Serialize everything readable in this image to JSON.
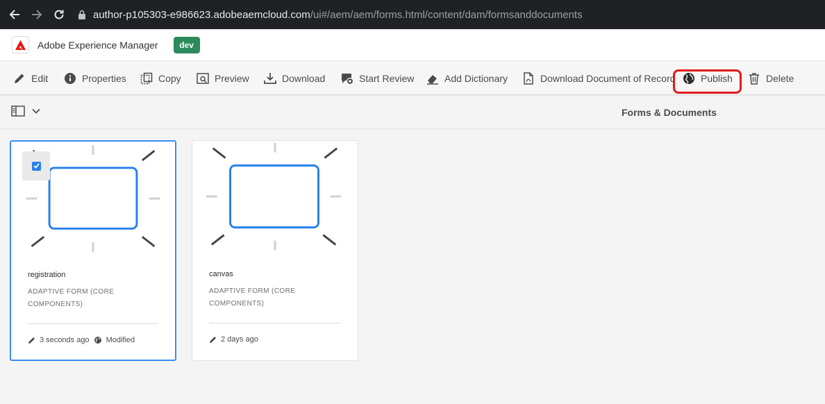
{
  "browser": {
    "url_host": "author-p105303-e986623.adobeaemcloud.com",
    "url_path": "/ui#/aem/aem/forms.html/content/dam/formsanddocuments"
  },
  "header": {
    "app_title": "Adobe Experience Manager",
    "env_badge": "dev"
  },
  "actions": [
    {
      "label": "Edit",
      "icon": "pencil-icon"
    },
    {
      "label": "Properties",
      "icon": "info-icon"
    },
    {
      "label": "Copy",
      "icon": "copy-icon"
    },
    {
      "label": "Preview",
      "icon": "preview-icon"
    },
    {
      "label": "Download",
      "icon": "download-icon"
    },
    {
      "label": "Start Review",
      "icon": "review-icon"
    },
    {
      "label": "Add Dictionary",
      "icon": "eraser-icon"
    },
    {
      "label": "Download Document of Record",
      "icon": "document-icon"
    },
    {
      "label": "Publish",
      "icon": "globe-icon"
    },
    {
      "label": "Delete",
      "icon": "trash-icon"
    }
  ],
  "title_bar": {
    "title": "Forms & Documents"
  },
  "cards": [
    {
      "name": "registration",
      "type": "ADAPTIVE FORM (CORE COMPONENTS)",
      "modified": "3 seconds ago",
      "status": "Modified",
      "selected": true
    },
    {
      "name": "canvas",
      "type": "ADAPTIVE FORM (CORE COMPONENTS)",
      "modified": "2 days ago",
      "status": "",
      "selected": false
    }
  ],
  "colors": {
    "accent": "#378ef0",
    "badge": "#2d8a5c",
    "highlight": "#e11a1a"
  }
}
